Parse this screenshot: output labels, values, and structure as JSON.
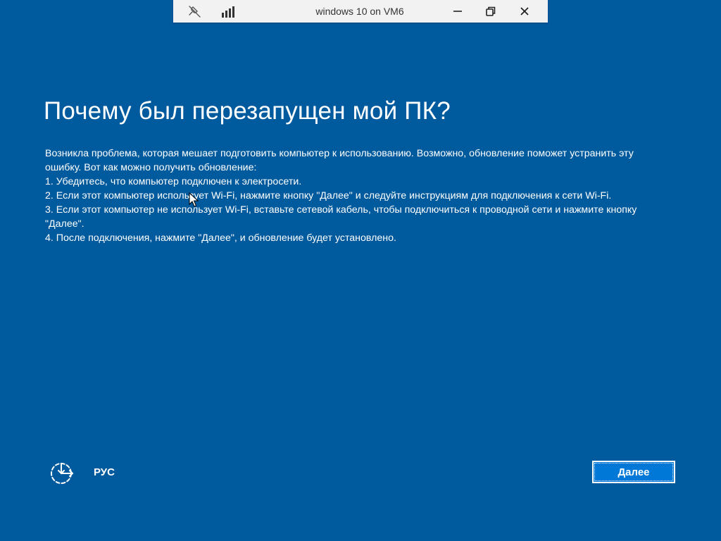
{
  "vm_bar": {
    "title": "windows 10 on VM6",
    "icons": [
      "pin-icon",
      "signal-icon",
      "minimize-icon",
      "restore-icon",
      "close-icon"
    ]
  },
  "main": {
    "title": "Почему был перезапущен мой ПК?",
    "lines": [
      "Возникла проблема, которая мешает подготовить компьютер к использованию. Возможно, обновление поможет устранить эту",
      "ошибку. Вот как можно получить обновление:",
      "1. Убедитесь, что компьютер подключен к электросети.",
      "2. Если этот компьютер использует Wi-Fi, нажмите кнопку \"Далее\" и следуйте инструкциям для подключения к сети Wi-Fi.",
      "3. Если этот компьютер не использует Wi-Fi, вставьте сетевой кабель, чтобы подключиться к проводной сети и нажмите кнопку",
      "\"Далее\".",
      "4. После подключения, нажмите \"Далее\", и обновление будет установлено."
    ]
  },
  "footer": {
    "language": "РУС",
    "next_label": "Далее",
    "accessibility_icon": "ease-of-access-icon"
  },
  "colors": {
    "background": "#005a9e",
    "button": "#0078d7",
    "text": "#ffffff",
    "vm_bar": "#f2f2f2"
  }
}
